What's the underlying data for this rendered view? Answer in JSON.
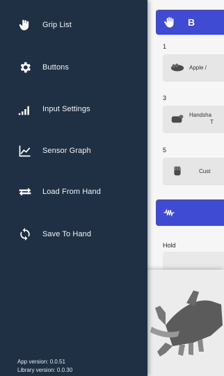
{
  "drawer": {
    "items": [
      {
        "label": "Grip List",
        "icon": "hand-grip-icon"
      },
      {
        "label": "Buttons",
        "icon": "gear-icon"
      },
      {
        "label": "Input Settings",
        "icon": "signal-bars-icon"
      },
      {
        "label": "Sensor Graph",
        "icon": "line-chart-icon"
      },
      {
        "label": "Load From Hand",
        "icon": "swap-arrows-icon"
      },
      {
        "label": "Save To Hand",
        "icon": "sync-icon"
      }
    ],
    "app_version": "App version: 0.0.51",
    "library_version": "Library version: 0.0.30"
  },
  "main": {
    "header_partial": "B",
    "slots": [
      {
        "number": "1",
        "label": "Apple /"
      },
      {
        "number": "3",
        "label_line1": "Handsha",
        "label_line2": "T"
      },
      {
        "number": "5",
        "label": "Cust"
      }
    ],
    "hold_label": "Hold"
  },
  "colors": {
    "drawer_bg": "#1f3044",
    "accent": "#3f4bd3",
    "card_bg": "#e6e6e6"
  }
}
